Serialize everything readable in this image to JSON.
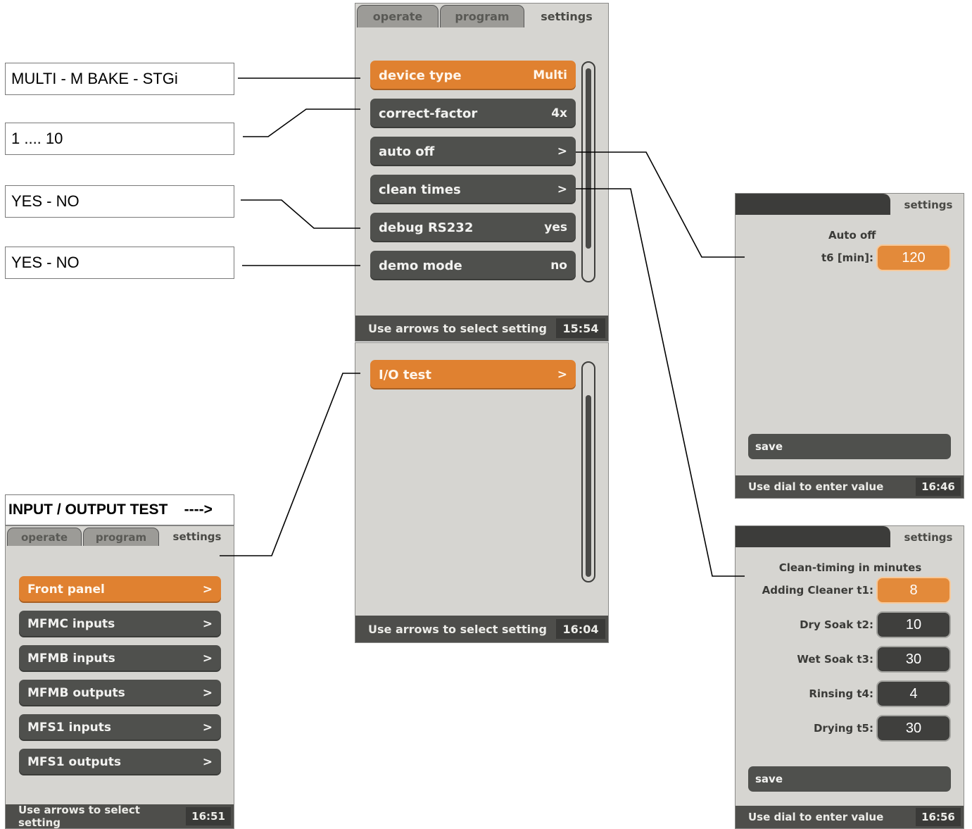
{
  "annotations": {
    "device_type_range": "MULTI - M BAKE - STGi",
    "correct_factor_range": "1 .... 10",
    "debug_options": "YES - NO",
    "demo_options": "YES - NO",
    "io_test_label": "INPUT / OUTPUT TEST    ---->"
  },
  "main_panel": {
    "tabs": {
      "operate": "operate",
      "program": "program",
      "settings": "settings"
    },
    "items": [
      {
        "label": "device type",
        "value": "Multi"
      },
      {
        "label": "correct-factor",
        "value": "4x"
      },
      {
        "label": "auto off",
        "value": ">"
      },
      {
        "label": "clean times",
        "value": ">"
      },
      {
        "label": "debug RS232",
        "value": "yes"
      },
      {
        "label": "demo mode",
        "value": "no"
      }
    ],
    "status_text": "Use arrows to select setting",
    "time": "15:54"
  },
  "io_panel": {
    "items": [
      {
        "label": "I/O test",
        "value": ">"
      }
    ],
    "status_text": "Use arrows to select setting",
    "time": "16:04"
  },
  "test_panel": {
    "tabs": {
      "operate": "operate",
      "program": "program",
      "settings": "settings"
    },
    "items": [
      {
        "label": "Front panel",
        "value": ">"
      },
      {
        "label": "MFMC inputs",
        "value": ">"
      },
      {
        "label": "MFMB inputs",
        "value": ">"
      },
      {
        "label": "MFMB outputs",
        "value": ">"
      },
      {
        "label": "MFS1 inputs",
        "value": ">"
      },
      {
        "label": "MFS1 outputs",
        "value": ">"
      }
    ],
    "status_text": "Use arrows to select setting",
    "time": "16:51"
  },
  "autooff_panel": {
    "tab": "settings",
    "title": "Auto off",
    "field_label": "t6 [min]:",
    "field_value": "120",
    "save": "save",
    "status_text": "Use dial to enter value",
    "time": "16:46"
  },
  "clean_panel": {
    "tab": "settings",
    "title": "Clean-timing in minutes",
    "fields": [
      {
        "label": "Adding Cleaner t1:",
        "value": "8"
      },
      {
        "label": "Dry Soak t2:",
        "value": "10"
      },
      {
        "label": "Wet Soak t3:",
        "value": "30"
      },
      {
        "label": "Rinsing t4:",
        "value": "4"
      },
      {
        "label": "Drying t5:",
        "value": "30"
      }
    ],
    "save": "save",
    "status_text": "Use dial to enter value",
    "time": "16:56"
  },
  "colors": {
    "accent": "#e08130",
    "item_dark": "#4f504d",
    "panel_bg": "#d6d5d1",
    "status_bg": "#4e4e4b"
  }
}
